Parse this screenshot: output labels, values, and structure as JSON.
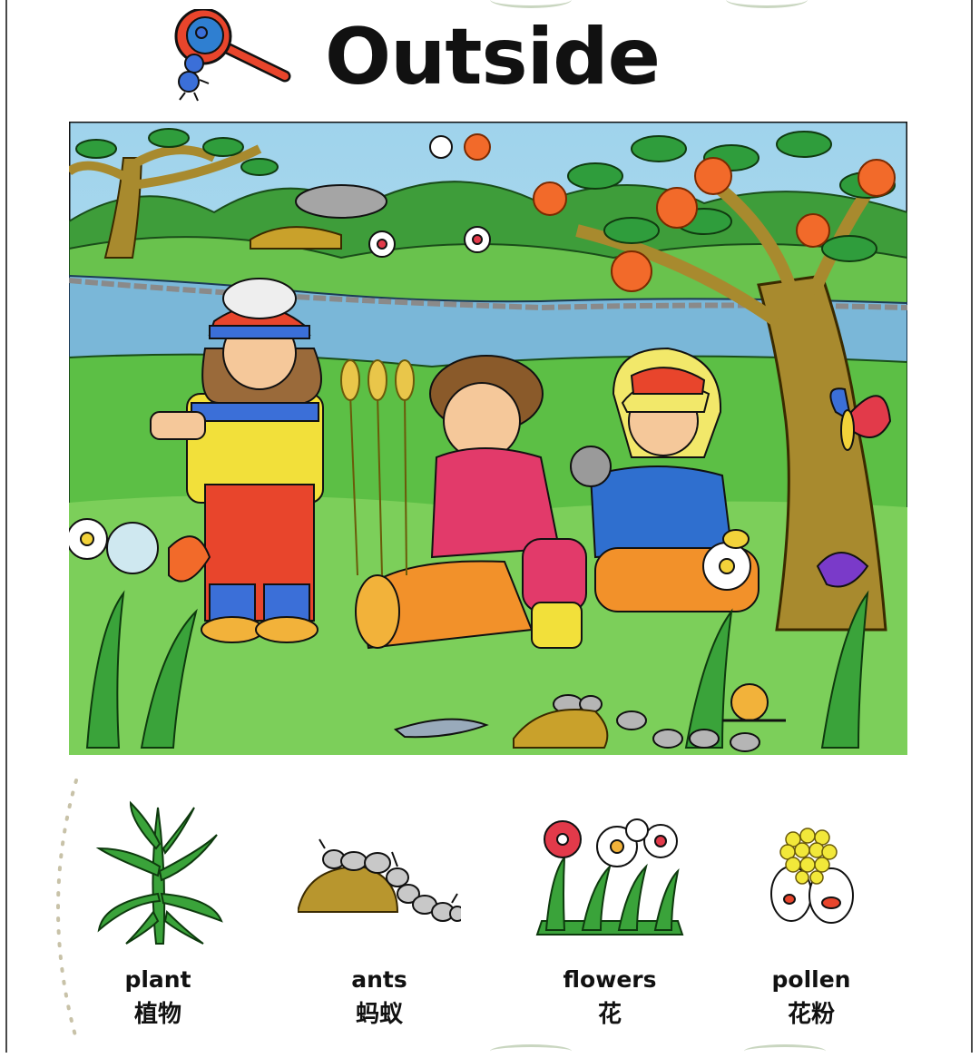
{
  "title": "Outside",
  "vocabulary": [
    {
      "word": "plant",
      "chinese": "植物",
      "icon": "plant-icon"
    },
    {
      "word": "ants",
      "chinese": "蚂蚁",
      "icon": "ants-icon"
    },
    {
      "word": "flowers",
      "chinese": "花",
      "icon": "flowers-icon"
    },
    {
      "word": "pollen",
      "chinese": "花粉",
      "icon": "pollen-icon"
    }
  ],
  "colors": {
    "sky": "#8fc9e6",
    "grass": "#5cbf45",
    "river": "#7ab7d8",
    "trunk": "#a88a2e",
    "orange": "#f26a2a"
  }
}
